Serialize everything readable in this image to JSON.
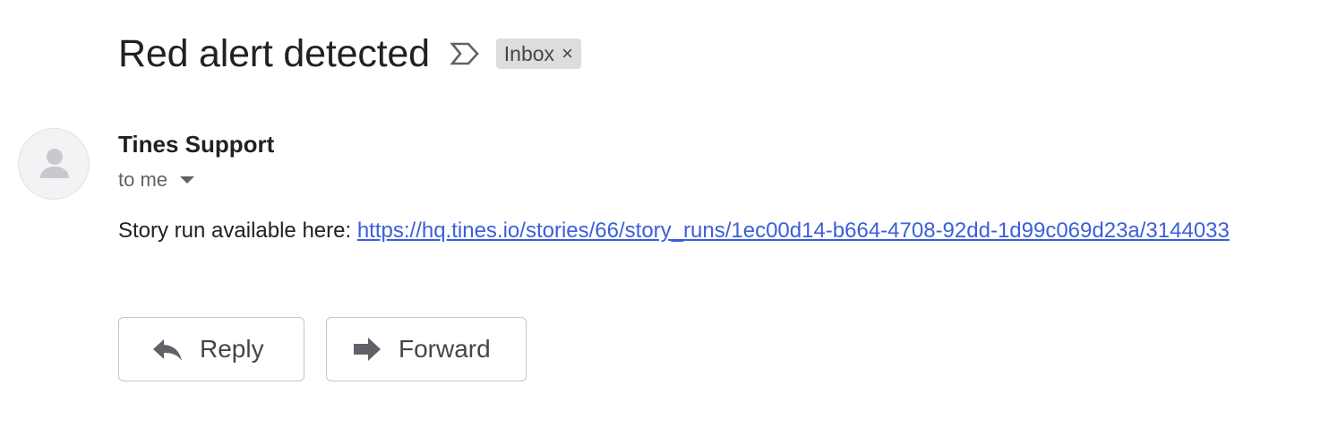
{
  "email": {
    "subject": "Red alert detected",
    "label_chip": "Inbox",
    "label_remove": "×",
    "sender": "Tines Support",
    "recipient": "to me",
    "body_prefix": "Story run available here:",
    "link_text": "https://hq.tines.io/stories/66/story_runs/1ec00d14-b664-4708-92dd-1d99c069d23a/3144033"
  },
  "actions": {
    "reply_label": "Reply",
    "forward_label": "Forward"
  },
  "icons": {
    "importance": "importance-marker-icon",
    "avatar": "person-icon",
    "dropdown": "chevron-down-icon",
    "reply": "reply-arrow-icon",
    "forward": "forward-arrow-icon"
  },
  "colors": {
    "link": "#3c5fd9",
    "chip_background": "#dddddd",
    "button_border": "#c4c7c5"
  }
}
